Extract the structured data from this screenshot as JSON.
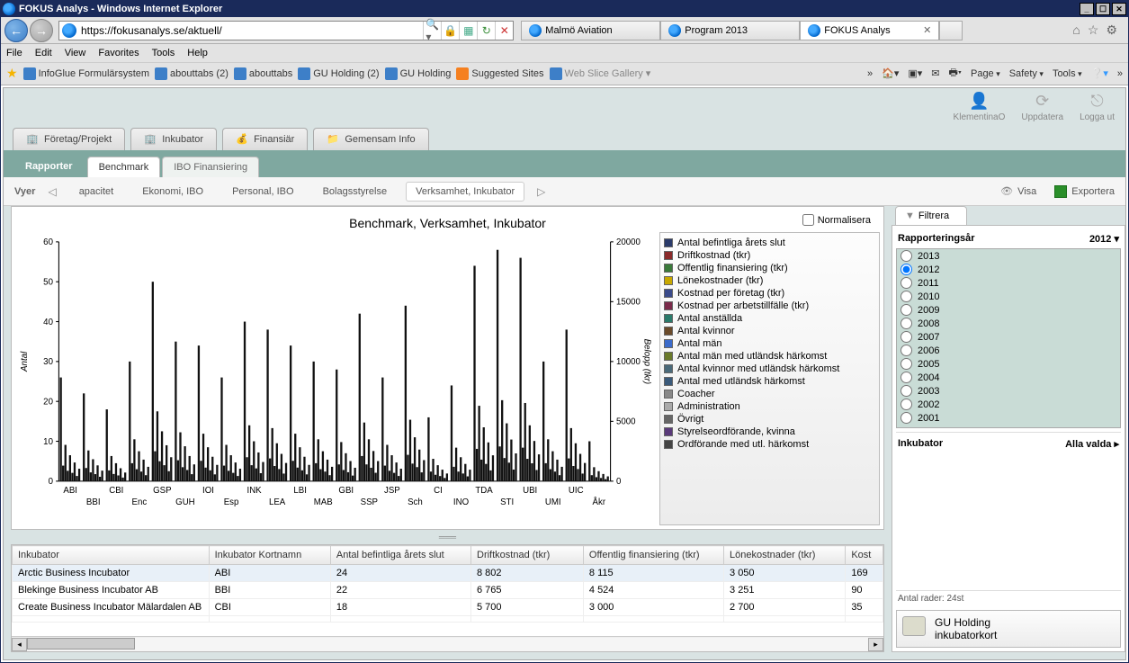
{
  "window": {
    "title": "FOKUS Analys - Windows Internet Explorer"
  },
  "address": {
    "url": "https://fokusanalys.se/aktuell/"
  },
  "ie_tabs": [
    {
      "label": "Malmö Aviation",
      "active": false
    },
    {
      "label": "Program 2013",
      "active": false
    },
    {
      "label": "FOKUS Analys",
      "active": true
    }
  ],
  "menubar": [
    "File",
    "Edit",
    "View",
    "Favorites",
    "Tools",
    "Help"
  ],
  "favbar": {
    "items": [
      {
        "label": "InfoGlue Formulärsystem",
        "icon": "blue"
      },
      {
        "label": "abouttabs (2)",
        "icon": "blue"
      },
      {
        "label": "abouttabs",
        "icon": "blue"
      },
      {
        "label": "GU Holding (2)",
        "icon": "blue"
      },
      {
        "label": "GU Holding",
        "icon": "blue"
      },
      {
        "label": "Suggested Sites",
        "icon": "orange"
      },
      {
        "label": "Web Slice Gallery",
        "icon": "blue",
        "grey": true
      }
    ],
    "right": {
      "page": "Page",
      "safety": "Safety",
      "tools": "Tools"
    }
  },
  "app_header": [
    {
      "label": "KlementinaO",
      "glyph": "👤"
    },
    {
      "label": "Uppdatera",
      "glyph": "⟳"
    },
    {
      "label": "Logga ut",
      "glyph": "⎋"
    }
  ],
  "main_tabs": [
    {
      "label": "Företag/Projekt"
    },
    {
      "label": "Inkubator"
    },
    {
      "label": "Finansiär"
    },
    {
      "label": "Gemensam Info"
    }
  ],
  "rapporter_label": "Rapporter",
  "sub_tabs": [
    {
      "label": "Benchmark",
      "active": true
    },
    {
      "label": "IBO Finansiering",
      "active": false
    }
  ],
  "vyer_label": "Vyer",
  "view_items": [
    {
      "label": "apacitet",
      "trunc": true
    },
    {
      "label": "Ekonomi, IBO"
    },
    {
      "label": "Personal, IBO"
    },
    {
      "label": "Bolagsstyrelse"
    },
    {
      "label": "Verksamhet, Inkubator",
      "active": true
    }
  ],
  "actions": {
    "visa": "Visa",
    "exportera": "Exportera"
  },
  "normalize_label": "Normalisera",
  "chart_title": "Benchmark, Verksamhet, Inkubator",
  "chart_data": {
    "type": "bar",
    "title": "Benchmark, Verksamhet, Inkubator",
    "ylabel_left": "Antal",
    "ylabel_right": "Belopp (tkr)",
    "ylim_left": [
      0,
      60
    ],
    "ylim_right": [
      0,
      20000
    ],
    "categories_row1": [
      "ABI",
      "CBI",
      "GSP",
      "IOI",
      "INK",
      "LBI",
      "GBI",
      "JSP",
      "CI",
      "TDA",
      "UBI",
      "UIC"
    ],
    "categories_row2": [
      "BBI",
      "Enc",
      "GUH",
      "Esp",
      "LEA",
      "MAB",
      "SSP",
      "Sch",
      "INO",
      "STI",
      "UMI",
      "Åkr"
    ],
    "series_legend": [
      "Antal befintliga årets slut",
      "Driftkostnad (tkr)",
      "Offentlig finansiering (tkr)",
      "Lönekostnader (tkr)",
      "Kostnad per företag (tkr)",
      "Kostnad per arbetstillfälle (tkr)",
      "Antal anställda",
      "Antal kvinnor",
      "Antal män",
      "Antal män med utländsk härkomst",
      "Antal kvinnor med utländsk härkomst",
      "Antal med utländsk härkomst",
      "Coacher",
      "Administration",
      "Övrigt",
      "Styrelseordförande, kvinna",
      "Ordförande med utl. härkomst"
    ],
    "note": "Grouped bars per incubator; approx 8+ series per group. Primary peak per group estimated from left axis.",
    "approx_peak_values_left_axis": {
      "ABI": 26,
      "BBI": 22,
      "CBI": 18,
      "Enc": 30,
      "GSP": 50,
      "GUH": 35,
      "IOI": 34,
      "Esp": 26,
      "INK": 40,
      "LEA": 38,
      "LBI": 34,
      "MAB": 30,
      "GBI": 28,
      "SSP": 42,
      "JSP": 26,
      "Sch": 44,
      "CI": 16,
      "INO": 24,
      "TDA": 54,
      "STI": 58,
      "UBI": 56,
      "UMI": 30,
      "UIC": 38,
      "Åkr": 10
    }
  },
  "legend_colors": [
    "#2a3a6a",
    "#8a2a2a",
    "#3a7a3a",
    "#c8a800",
    "#3a4a8a",
    "#7a2a4a",
    "#2a7a6a",
    "#6a4a2a",
    "#3a6aca",
    "#6a7a2a",
    "#4a6a7a",
    "#3a5a7a",
    "#888",
    "#aaa",
    "#666",
    "#5a3a7a",
    "#444"
  ],
  "grid": {
    "cols": [
      "Inkubator",
      "Inkubator Kortnamn",
      "Antal befintliga årets slut",
      "Driftkostnad (tkr)",
      "Offentlig finansiering (tkr)",
      "Lönekostnader (tkr)",
      "Kost"
    ],
    "rows": [
      [
        "Arctic Business Incubator",
        "ABI",
        "24",
        "8 802",
        "8 115",
        "3 050",
        "169"
      ],
      [
        "Blekinge Business Incubator AB",
        "BBI",
        "22",
        "6 765",
        "4 524",
        "3 251",
        "90"
      ],
      [
        "Create Business Incubator Mälardalen AB",
        "CBI",
        "18",
        "5 700",
        "3 000",
        "2 700",
        "35"
      ],
      [
        "",
        "",
        "",
        "",
        "",
        "",
        ""
      ]
    ]
  },
  "filter": {
    "tab": "Filtrera",
    "report_year_label": "Rapporteringsår",
    "report_year_value": "2012",
    "years": [
      "2013",
      "2012",
      "2011",
      "2010",
      "2009",
      "2008",
      "2007",
      "2006",
      "2005",
      "2004",
      "2003",
      "2002",
      "2001"
    ],
    "selected_year": "2012",
    "inkubator_label": "Inkubator",
    "inkubator_value": "Alla valda",
    "antal_rader": "Antal rader:  24st",
    "gu": {
      "l1": "GU Holding",
      "l2": "inkubatorkort"
    }
  }
}
